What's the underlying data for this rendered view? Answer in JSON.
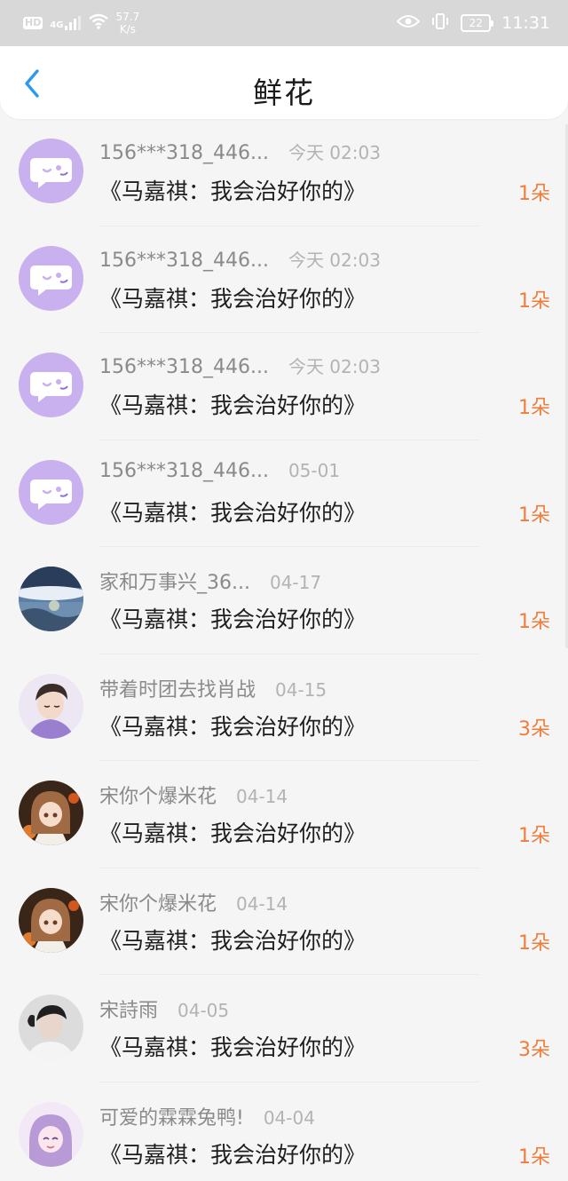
{
  "status_bar": {
    "hd": "HD",
    "network": "4G",
    "speed_value": "57.7",
    "speed_unit": "K/s",
    "battery": "22",
    "time": "11:31"
  },
  "header": {
    "title": "鲜花"
  },
  "colors": {
    "accent_blue": "#2a9af0",
    "count_orange": "#ee7d3c",
    "default_avatar_purple": "#c9b0ef"
  },
  "gifts": [
    {
      "user": "156***318_446...",
      "time": "今天 02:03",
      "book": "《马嘉祺：我会治好你的》",
      "count": "1朵",
      "avatar": "default-avatar"
    },
    {
      "user": "156***318_446...",
      "time": "今天 02:03",
      "book": "《马嘉祺：我会治好你的》",
      "count": "1朵",
      "avatar": "default-avatar"
    },
    {
      "user": "156***318_446...",
      "time": "今天 02:03",
      "book": "《马嘉祺：我会治好你的》",
      "count": "1朵",
      "avatar": "default-avatar"
    },
    {
      "user": "156***318_446...",
      "time": "05-01",
      "book": "《马嘉祺：我会治好你的》",
      "count": "1朵",
      "avatar": "default-avatar"
    },
    {
      "user": "家和万事兴_36...",
      "time": "04-17",
      "book": "《马嘉祺：我会治好你的》",
      "count": "1朵",
      "avatar": "landscape-photo"
    },
    {
      "user": "带着时团去找肖战",
      "time": "04-15",
      "book": "《马嘉祺：我会治好你的》",
      "count": "3朵",
      "avatar": "person-photo"
    },
    {
      "user": "宋你个爆米花",
      "time": "04-14",
      "book": "《马嘉祺：我会治好你的》",
      "count": "1朵",
      "avatar": "anime-girl"
    },
    {
      "user": "宋你个爆米花",
      "time": "04-14",
      "book": "《马嘉祺：我会治好你的》",
      "count": "1朵",
      "avatar": "anime-girl"
    },
    {
      "user": "宋詩雨",
      "time": "04-05",
      "book": "《马嘉祺：我会治好你的》",
      "count": "3朵",
      "avatar": "person-photo-bw"
    },
    {
      "user": "可爱的霖霖兔鸭!",
      "time": "04-04",
      "book": "《马嘉祺：我会治好你的》",
      "count": "1朵",
      "avatar": "anime-purple"
    }
  ]
}
